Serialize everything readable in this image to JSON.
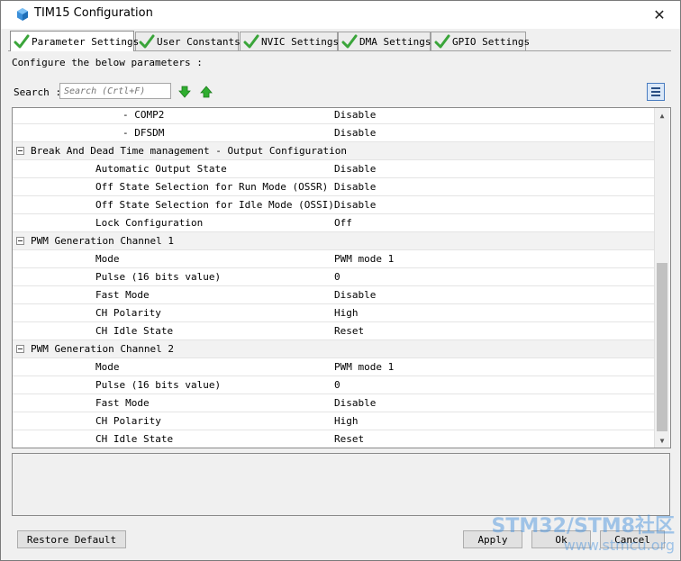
{
  "window": {
    "title": "TIM15 Configuration",
    "close_icon": "close-icon"
  },
  "tabs": [
    {
      "label": "Parameter Settings",
      "active": true
    },
    {
      "label": "User Constants",
      "active": false
    },
    {
      "label": "NVIC Settings",
      "active": false
    },
    {
      "label": "DMA Settings",
      "active": false
    },
    {
      "label": "GPIO Settings",
      "active": false
    }
  ],
  "panel": {
    "configure_text": "Configure the below parameters :",
    "search_label": "Search :",
    "search_placeholder": "Search (Crtl+F)"
  },
  "params": {
    "comp2": {
      "name": "- COMP2",
      "value": "Disable"
    },
    "dfsdm": {
      "name": "- DFSDM",
      "value": "Disable"
    },
    "group_break": "Break And Dead Time management - Output Configuration",
    "auto_output": {
      "name": "Automatic Output State",
      "value": "Disable"
    },
    "ossr": {
      "name": "Off State Selection for Run Mode (OSSR)",
      "value": "Disable"
    },
    "ossi": {
      "name": "Off State Selection for Idle Mode (OSSI)",
      "value": "Disable"
    },
    "lock": {
      "name": "Lock Configuration",
      "value": "Off"
    },
    "group_pwm1": "PWM Generation Channel 1",
    "ch1_mode": {
      "name": "Mode",
      "value": "PWM mode 1"
    },
    "ch1_pulse": {
      "name": "Pulse (16 bits value)",
      "value": "0"
    },
    "ch1_fast": {
      "name": "Fast Mode",
      "value": "Disable"
    },
    "ch1_pol": {
      "name": "CH Polarity",
      "value": "High"
    },
    "ch1_idle": {
      "name": "CH Idle State",
      "value": "Reset"
    },
    "group_pwm2": "PWM Generation Channel 2",
    "ch2_mode": {
      "name": "Mode",
      "value": "PWM mode 1"
    },
    "ch2_pulse": {
      "name": "Pulse (16 bits value)",
      "value": "0"
    },
    "ch2_fast": {
      "name": "Fast Mode",
      "value": "Disable"
    },
    "ch2_pol": {
      "name": "CH Polarity",
      "value": "High"
    },
    "ch2_idle": {
      "name": "CH Idle State",
      "value": "Reset"
    }
  },
  "buttons": {
    "restore": "Restore Default",
    "apply": "Apply",
    "ok": "Ok",
    "cancel": "Cancel"
  },
  "watermark": {
    "line1": "STM32/STM8社区",
    "line2": "www.stmcu.org"
  },
  "colors": {
    "check_green": "#3aa53a",
    "arrow_green": "#2fae2f",
    "selection_blue": "#4a7dc0"
  }
}
